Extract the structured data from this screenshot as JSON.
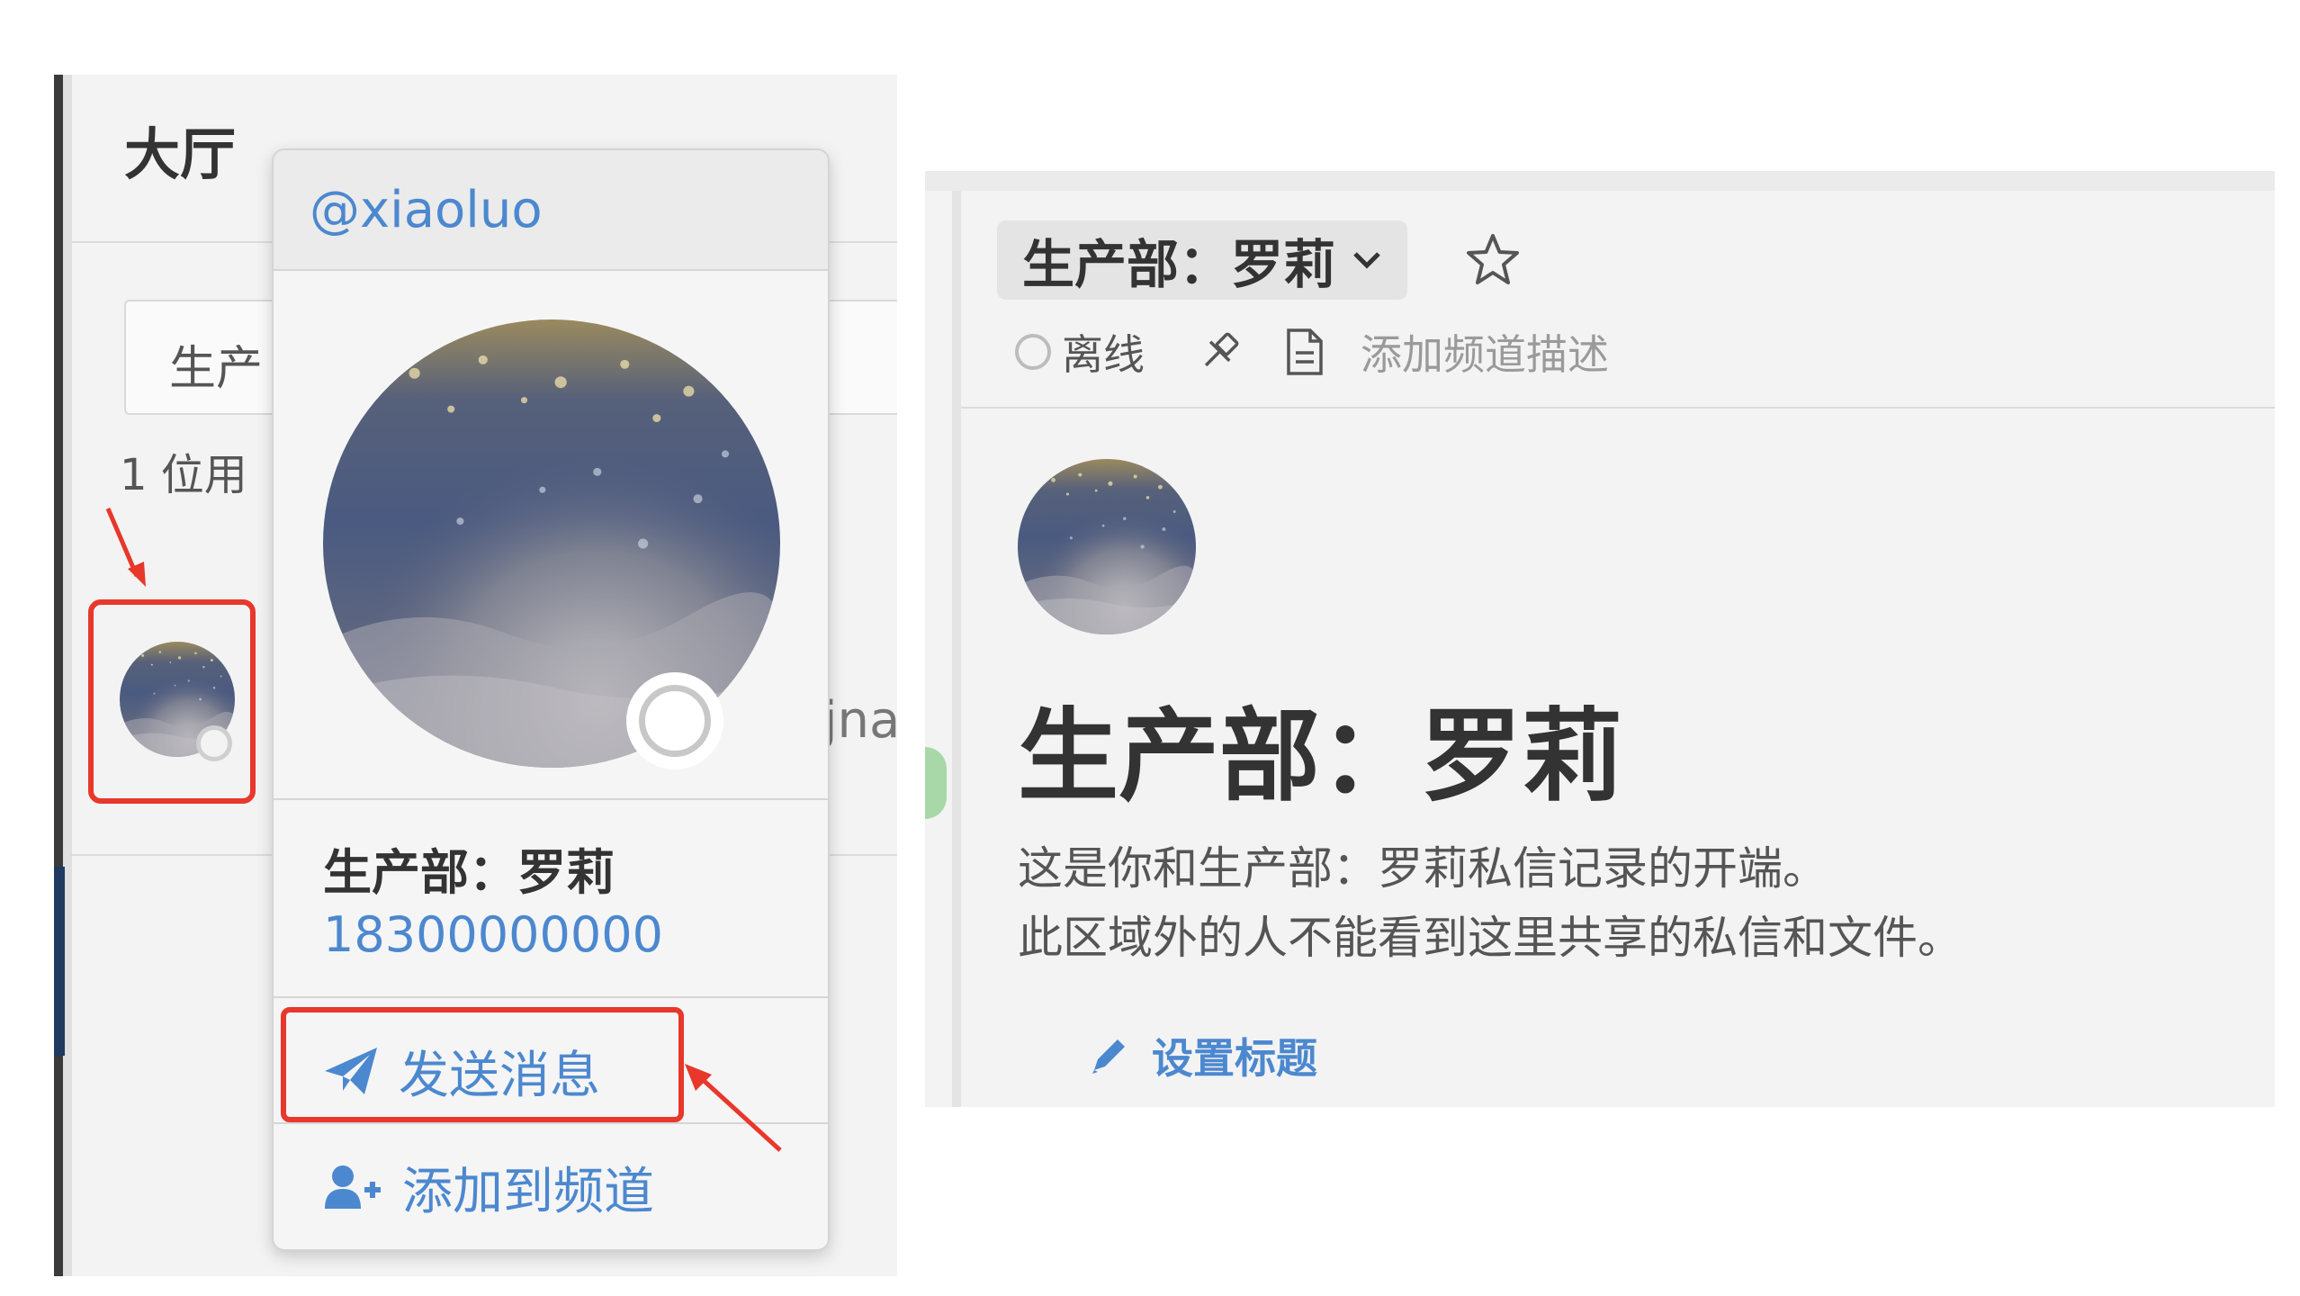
{
  "left": {
    "hall_title": "大厅",
    "search_text": "生产",
    "member_count": "1 位用",
    "member_name_peek": "jna"
  },
  "popover": {
    "username": "@xiaoluo",
    "full_name": "生产部：罗莉",
    "phone": "18300000000",
    "send_message_label": "发送消息",
    "add_to_channel_label": "添加到频道",
    "send_icon": "paper-plane-icon",
    "add_icon": "add-user-icon"
  },
  "right": {
    "channel_name": "生产部：罗莉",
    "status": "离线",
    "add_description": "添加频道描述",
    "dm_title": "生产部：罗莉",
    "intro_line1": "这是你和生产部：罗莉私信记录的开端。",
    "intro_line2": "此区域外的人不能看到这里共享的私信和文件。",
    "set_title_label": "设置标题"
  },
  "colors": {
    "link_blue": "#4c88cf",
    "highlight_red": "#e8372b",
    "panel_bg": "#f3f3f3"
  }
}
